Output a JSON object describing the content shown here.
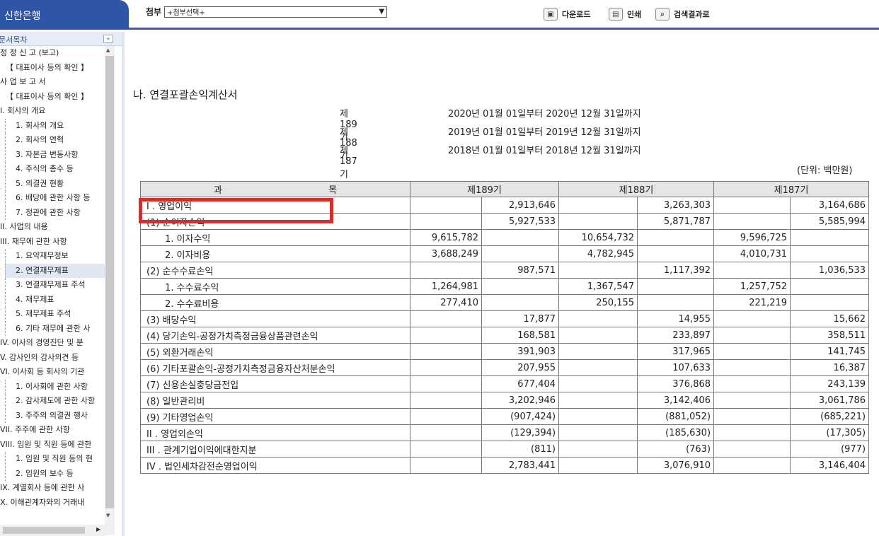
{
  "header": {
    "logo": "신한은행",
    "attach_label": "첨부",
    "attach_value": "+첨부선택+",
    "download": "다운로드",
    "print": "인쇄",
    "back_to_results": "검색결과로"
  },
  "sidebar": {
    "title": "문서목차",
    "items": [
      {
        "label": "정 정 신 고 (보고)",
        "level": 0
      },
      {
        "label": "【 대표이사 등의 확인 】",
        "level": 1
      },
      {
        "label": "사 업 보 고 서",
        "level": 0
      },
      {
        "label": "【 대표이사 등의 확인 】",
        "level": 1
      },
      {
        "label": "I. 회사의 개요",
        "level": 0
      },
      {
        "label": "1. 회사의 개요",
        "level": 2
      },
      {
        "label": "2. 회사의 연혁",
        "level": 2
      },
      {
        "label": "3. 자본금 변동사항",
        "level": 2
      },
      {
        "label": "4. 주식의 총수 등",
        "level": 2
      },
      {
        "label": "5. 의결권 현황",
        "level": 2
      },
      {
        "label": "6. 배당에 관한 사항 등",
        "level": 2
      },
      {
        "label": "7. 정관에 관한 사항",
        "level": 2
      },
      {
        "label": "II. 사업의 내용",
        "level": 0
      },
      {
        "label": "III. 재무에 관한 사항",
        "level": 0
      },
      {
        "label": "1. 요약재무정보",
        "level": 2
      },
      {
        "label": "2. 연결재무제표",
        "level": 2,
        "active": true
      },
      {
        "label": "3. 연결재무제표 주석",
        "level": 2
      },
      {
        "label": "4. 재무제표",
        "level": 2
      },
      {
        "label": "5. 재무제표 주석",
        "level": 2
      },
      {
        "label": "6. 기타 재무에 관한 사",
        "level": 2
      },
      {
        "label": "IV. 이사의 경영진단 및 분",
        "level": 0
      },
      {
        "label": "V. 감사인의 감사의견 등",
        "level": 0
      },
      {
        "label": "VI. 이사회 등 회사의 기관",
        "level": 0
      },
      {
        "label": "1. 이사회에 관한 사항",
        "level": 2
      },
      {
        "label": "2. 감사제도에 관한 사항",
        "level": 2
      },
      {
        "label": "3. 주주의 의결권 행사",
        "level": 2
      },
      {
        "label": "VII. 주주에 관한 사항",
        "level": 0
      },
      {
        "label": "VIII. 임원 및 직원 등에 관한",
        "level": 0
      },
      {
        "label": "1. 임원 및 직원 등의 현",
        "level": 2
      },
      {
        "label": "2. 임원의 보수 등",
        "level": 2
      },
      {
        "label": "IX. 계열회사 등에 관한 사",
        "level": 0
      },
      {
        "label": "X. 이해관계자와의 거래내",
        "level": 0
      }
    ]
  },
  "document": {
    "title": "나. 연결포괄손익계산서",
    "periods": [
      {
        "term": "제189기",
        "range": "2020년 01월 01일부터  2020년 12월 31일까지"
      },
      {
        "term": "제188기",
        "range": "2019년 01월 01일부터  2019년 12월 31일까지"
      },
      {
        "term": "제187기",
        "range": "2018년 01월 01일부터  2018년 12월 31일까지"
      }
    ],
    "unit": "(단위: 백만원)",
    "table": {
      "headers": [
        "과",
        "목",
        "제189기",
        "제188기",
        "제187기"
      ],
      "rows": [
        {
          "label": "I . 영업이익",
          "v": [
            "",
            "2,913,646",
            "",
            "3,263,303",
            "",
            "3,164,686"
          ]
        },
        {
          "label": "(1) 순이자손익",
          "v": [
            "",
            "5,927,533",
            "",
            "5,871,787",
            "",
            "5,585,994"
          ]
        },
        {
          "label": "1. 이자수익",
          "indent": true,
          "v": [
            "9,615,782",
            "",
            "10,654,732",
            "",
            "9,596,725",
            ""
          ]
        },
        {
          "label": "2. 이자비용",
          "indent": true,
          "v": [
            "3,688,249",
            "",
            "4,782,945",
            "",
            "4,010,731",
            ""
          ]
        },
        {
          "label": "(2) 순수수료손익",
          "v": [
            "",
            "987,571",
            "",
            "1,117,392",
            "",
            "1,036,533"
          ]
        },
        {
          "label": "1. 수수료수익",
          "indent": true,
          "v": [
            "1,264,981",
            "",
            "1,367,547",
            "",
            "1,257,752",
            ""
          ]
        },
        {
          "label": "2. 수수료비용",
          "indent": true,
          "v": [
            "277,410",
            "",
            "250,155",
            "",
            "221,219",
            ""
          ]
        },
        {
          "label": "(3) 배당수익",
          "v": [
            "",
            "17,877",
            "",
            "14,955",
            "",
            "15,662"
          ]
        },
        {
          "label": "(4) 당기손익-공정가치측정금융상품관련손익",
          "v": [
            "",
            "168,581",
            "",
            "233,897",
            "",
            "358,511"
          ]
        },
        {
          "label": "(5) 외환거래손익",
          "v": [
            "",
            "391,903",
            "",
            "317,965",
            "",
            "141,745"
          ]
        },
        {
          "label": "(6) 기타포괄손익-공정가치측정금융자산처분손익",
          "v": [
            "",
            "207,955",
            "",
            "107,633",
            "",
            "16,387"
          ]
        },
        {
          "label": "(7) 신용손실충당금전입",
          "v": [
            "",
            "677,404",
            "",
            "376,868",
            "",
            "243,139"
          ]
        },
        {
          "label": "(8) 일반관리비",
          "v": [
            "",
            "3,202,946",
            "",
            "3,142,406",
            "",
            "3,061,786"
          ]
        },
        {
          "label": "(9) 기타영업손익",
          "v": [
            "",
            "(907,424)",
            "",
            "(881,052)",
            "",
            "(685,221)"
          ]
        },
        {
          "label": "II . 영업외손익",
          "v": [
            "",
            "(129,394)",
            "",
            "(185,630)",
            "",
            "(17,305)"
          ]
        },
        {
          "label": "III . 관계기업이익에대한지분",
          "v": [
            "",
            "(811)",
            "",
            "(763)",
            "",
            "(977)"
          ]
        },
        {
          "label": "IV . 법인세차감전순영업이익",
          "v": [
            "",
            "2,783,441",
            "",
            "3,076,910",
            "",
            "3,146,404"
          ]
        }
      ]
    }
  }
}
